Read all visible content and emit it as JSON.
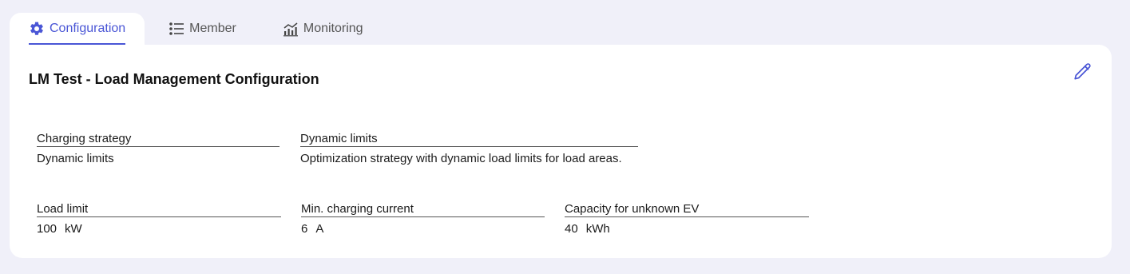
{
  "tabs": [
    {
      "label": "Configuration",
      "icon": "gear-icon",
      "active": true
    },
    {
      "label": "Member",
      "icon": "list-icon",
      "active": false
    },
    {
      "label": "Monitoring",
      "icon": "chart-icon",
      "active": false
    }
  ],
  "card": {
    "title": "LM Test - Load Management Configuration",
    "edit_icon": "pencil-icon"
  },
  "fields": {
    "charging_strategy": {
      "label": "Charging strategy",
      "value": "Dynamic limits"
    },
    "dynamic_limits": {
      "label": "Dynamic limits",
      "value": "Optimization strategy with dynamic load limits for load areas."
    },
    "load_limit": {
      "label": "Load limit",
      "value": "100",
      "unit": "kW"
    },
    "min_charging_current": {
      "label": "Min. charging current",
      "value": "6",
      "unit": "A"
    },
    "capacity_unknown_ev": {
      "label": "Capacity for unknown EV",
      "value": "40",
      "unit": "kWh"
    }
  },
  "colors": {
    "accent": "#4a56d6",
    "background": "#f0f0f9",
    "card": "#ffffff"
  }
}
